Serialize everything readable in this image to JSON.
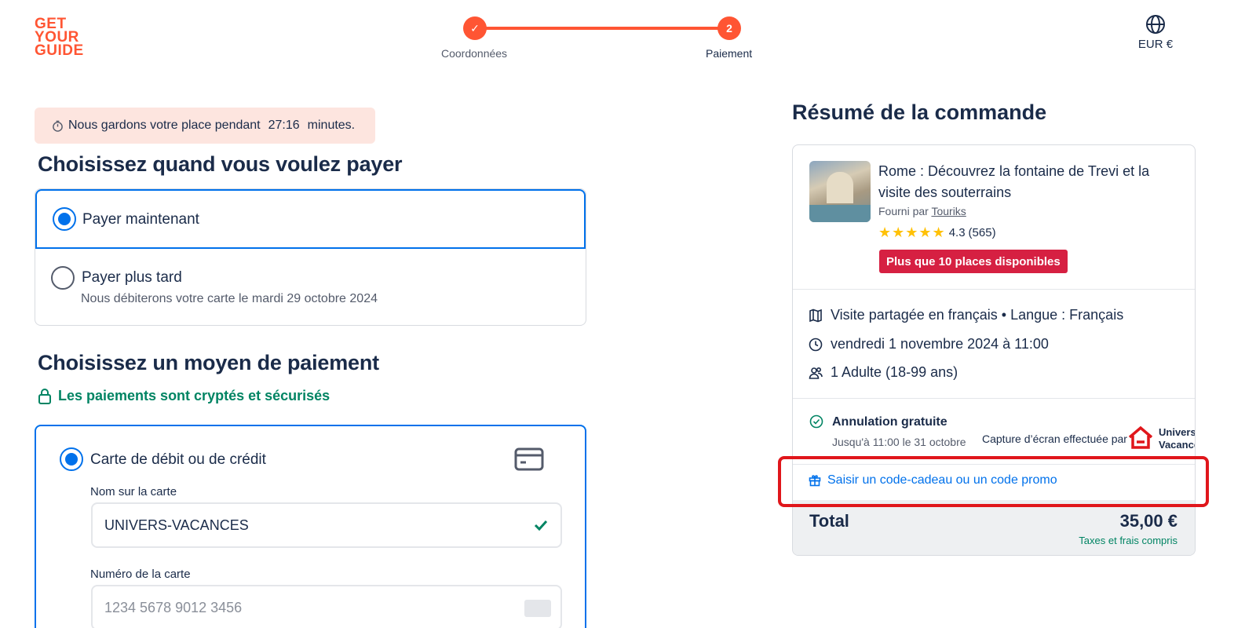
{
  "logo": {
    "line1": "GET",
    "line2": "YOUR",
    "line3": "GUIDE"
  },
  "stepper": {
    "step1_label": "Coordonnées",
    "step1_mark": "✓",
    "step2_number": "2",
    "step2_label": "Paiement"
  },
  "currency": {
    "label": "EUR €",
    "icon": "globe-icon"
  },
  "timer": {
    "prefix": "Nous gardons votre place pendant",
    "time": "27:16",
    "suffix": "minutes.",
    "icon": "stopwatch-icon"
  },
  "when_section": {
    "title": "Choisissez quand vous voulez payer",
    "options": [
      {
        "label": "Payer maintenant",
        "selected": true
      },
      {
        "label": "Payer plus tard",
        "sub": "Nous débiterons votre carte le mardi 29 octobre 2024",
        "selected": false
      }
    ]
  },
  "method_section": {
    "title": "Choisissez un moyen de paiement",
    "secure_text": "Les paiements sont cryptés et sécurisés",
    "card_option": "Carte de débit ou de crédit",
    "name_label": "Nom sur la carte",
    "name_value": "UNIVERS-VACANCES",
    "number_label": "Numéro de la carte",
    "number_placeholder": "1234 5678 9012 3456"
  },
  "summary": {
    "title": "Résumé de la commande",
    "tour_title": "Rome : Découvrez la fontaine de Trevi et la visite des souterrains",
    "provider_prefix": "Fourni par",
    "provider_name": "Touriks",
    "stars": "★★★★★",
    "rating": "4.3",
    "reviews": "(565)",
    "availability": "Plus que 10 places disponibles",
    "details": [
      {
        "icon": "map-icon",
        "text": "Visite partagée en français • Langue : Français"
      },
      {
        "icon": "clock-icon",
        "text": "vendredi 1 novembre 2024 à 11:00"
      },
      {
        "icon": "people-icon",
        "text": "1 Adulte (18-99 ans)"
      }
    ],
    "cancel_title": "Annulation gratuite",
    "cancel_sub": "Jusqu'à 11:00 le 31 octobre",
    "capture_text": "Capture d’écran effectuée par",
    "capture_brand_line1": "Univers",
    "capture_brand_line2": "Vacances",
    "promo_text": "Saisir un code-cadeau ou un code promo",
    "total_label": "Total",
    "total_value": "35,00 €",
    "total_note": "Taxes et frais compris"
  },
  "colors": {
    "brand": "#ff5533",
    "primary": "#0071eb",
    "success": "#008463",
    "badge": "#d62042",
    "highlight": "#e0161b"
  }
}
